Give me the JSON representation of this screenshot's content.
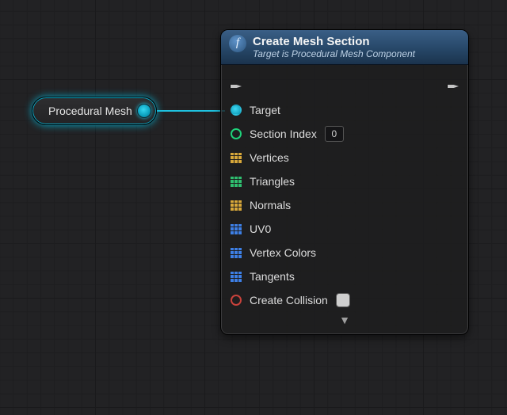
{
  "variable_node": {
    "label": "Procedural Mesh",
    "output_pin_type": "object"
  },
  "node": {
    "icon": "f",
    "title": "Create Mesh Section",
    "subtitle": "Target is Procedural Mesh Component",
    "pins": {
      "target": {
        "label": "Target",
        "connected": true
      },
      "section_index": {
        "label": "Section Index",
        "value": "0"
      },
      "vertices": {
        "label": "Vertices"
      },
      "triangles": {
        "label": "Triangles"
      },
      "normals": {
        "label": "Normals"
      },
      "uv0": {
        "label": "UV0"
      },
      "vertex_colors": {
        "label": "Vertex Colors"
      },
      "tangents": {
        "label": "Tangents"
      },
      "create_collision": {
        "label": "Create Collision",
        "checked": false
      }
    },
    "expand_glyph": "▼"
  }
}
